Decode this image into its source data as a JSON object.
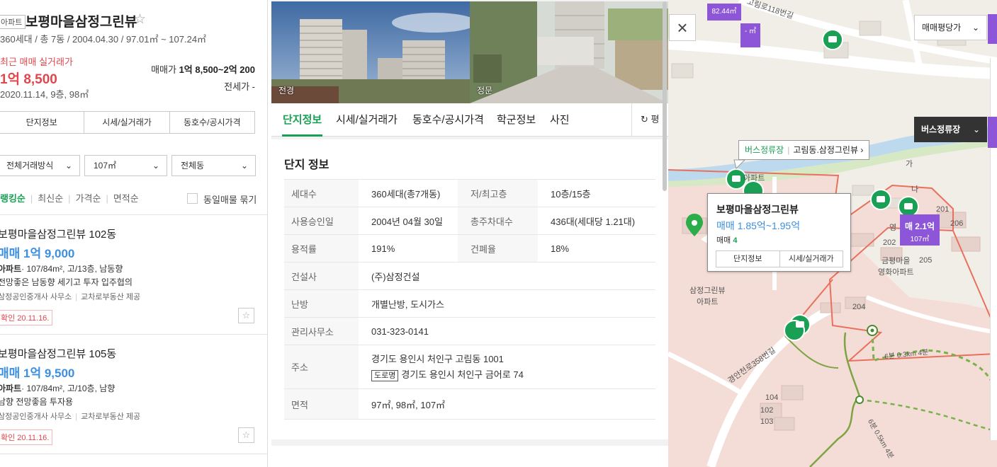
{
  "complex": {
    "type_badge": "아파트",
    "name": "보평마을삼정그린뷰",
    "star": "☆",
    "meta": "360세대 / 총 7동 / 2004.04.30 / 97.01㎡ ~ 107.24㎡",
    "recent_label": "최근 매매 실거래가",
    "recent_price": "1억 8,500",
    "recent_date": "2020.11.14, 9층, 98㎡",
    "sale_range_label": "매매가",
    "sale_range_value": "1억 8,500~2억 200",
    "jeonse": "전세가 -"
  },
  "left_tabs": [
    "단지정보",
    "시세/실거래가",
    "동호수/공시가격"
  ],
  "filters": [
    "전체거래방식",
    "107㎡",
    "전체동"
  ],
  "sort": {
    "items": [
      "랭킹순",
      "최신순",
      "가격순",
      "면적순"
    ],
    "same_listing": "동일매물 묶기"
  },
  "listings": [
    {
      "name": "보평마을삼정그린뷰 102동",
      "price": "매매 1억 9,000",
      "type": "아파트",
      "spec": "· 107/84m², 고/13층, 남동향",
      "desc": "전망좋은 남동향 세기고 투자 입주협의",
      "agent1": "삼정공인중개사 사무소",
      "agent2": "교차로부동산 제공",
      "confirm": "확인 20.11.16."
    },
    {
      "name": "보평마을삼정그린뷰 105동",
      "price": "매매 1억 9,500",
      "type": "아파트",
      "spec": "· 107/84m², 고/10층, 남향",
      "desc": "남향 전망좋음 투자용",
      "agent1": "삼정공인중개사 사무소",
      "agent2": "교차로부동산 제공",
      "confirm": "확인 20.11.16."
    }
  ],
  "photos": {
    "p1": "전경",
    "p2": "정문"
  },
  "mid_tabs": [
    "단지정보",
    "시세/실거래가",
    "동호수/공시가격",
    "학군정보",
    "사진"
  ],
  "refresh": "평",
  "info": {
    "heading": "단지 정보",
    "rows": [
      {
        "k": "세대수",
        "v": "360세대(총7개동)",
        "k2": "저/최고층",
        "v2": "10층/15층"
      },
      {
        "k": "사용승인일",
        "v": "2004년 04월 30일",
        "k2": "총주차대수",
        "v2": "436대(세대당 1.21대)"
      },
      {
        "k": "용적률",
        "v": "191%",
        "k2": "건폐율",
        "v2": "18%"
      },
      {
        "k": "건설사",
        "v": "(주)삼정건설"
      },
      {
        "k": "난방",
        "v": "개별난방, 도시가스"
      },
      {
        "k": "관리사무소",
        "v": "031-323-0141"
      }
    ],
    "address_key": "주소",
    "address_jibun": "경기도 용인시 처인구 고림동 1001",
    "road_badge": "도로명",
    "address_road": "경기도 용인시 처인구 금어로 74",
    "area_key": "면적",
    "area_value": "97㎡, 98㎡, 107㎡"
  },
  "map": {
    "close": "×",
    "price_select": "매매평당가",
    "bus_toggle": "버스정류장",
    "area_tag": "82.44㎡",
    "area_tag2": "- ㎡",
    "bus_label_prefix": "버스정류장",
    "bus_label_stop": "고림동.삼정그린뷰",
    "bus_label_arrow": "›",
    "popup_title": "보평마을삼정그린뷰",
    "popup_price": "매매 1.85억~1.95억",
    "popup_count_label": "매매",
    "popup_count": "4",
    "popup_btn1": "단지정보",
    "popup_btn2": "시세/실거래가",
    "price_tag": "매 2.1억",
    "price_tag_area": "107㎡",
    "labels": {
      "road1": "고림로118번길",
      "road2": "경안천로358번길",
      "complex": "삼정그린뷰\n아파트",
      "complex2": "금평마을\n영화아파트",
      "apt": "아파트",
      "trail": "6분 0.3km 4분",
      "trail2": "6분 0.5km 4분",
      "bld1": "201",
      "bld2": "202",
      "bld3": "204",
      "bld4": "205",
      "bld5": "206",
      "bld6": "104",
      "bld7": "102",
      "bld8": "103",
      "ga": "가",
      "na": "나",
      "young": "영"
    }
  }
}
